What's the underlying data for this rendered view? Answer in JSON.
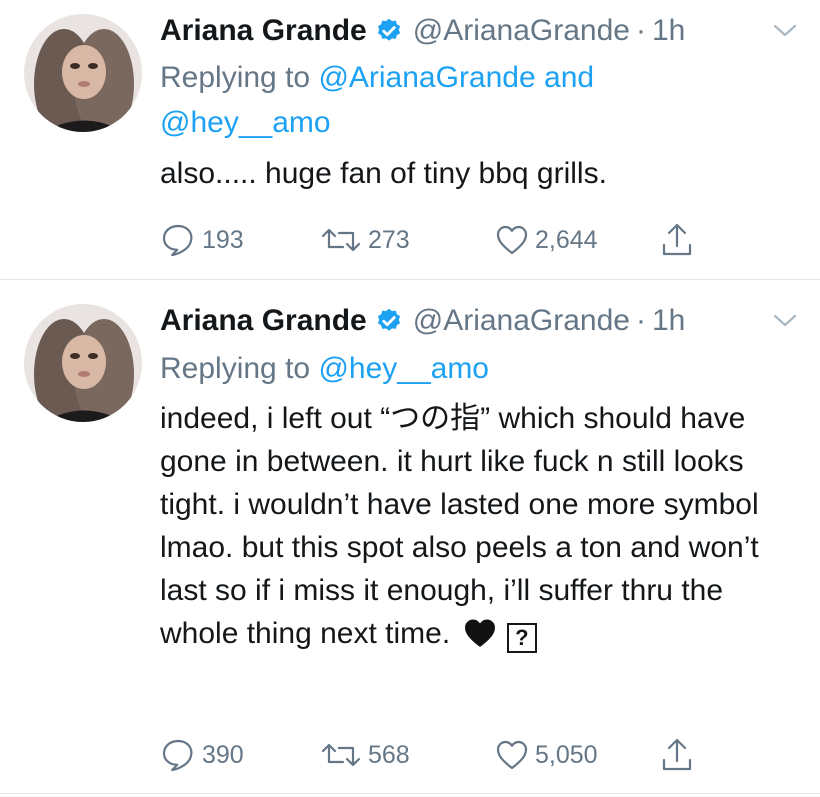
{
  "colors": {
    "text": "#14171a",
    "secondary": "#657786",
    "link": "#1da1f2",
    "verified": "#1da1f2",
    "divider": "#e1e8ed"
  },
  "tweets": [
    {
      "author_name": "Ariana Grande",
      "handle": "@ArianaGrande",
      "separator": "·",
      "time": "1h",
      "replying_prefix": "Replying to",
      "replying_mention_1": "@ArianaGrande",
      "replying_and": "and",
      "replying_mention_2": "@hey__amo",
      "text": "also..... huge fan of tiny bbq grills.",
      "replies": "193",
      "retweets": "273",
      "likes": "2,644"
    },
    {
      "author_name": "Ariana Grande",
      "handle": "@ArianaGrande",
      "separator": "·",
      "time": "1h",
      "replying_prefix": "Replying to",
      "replying_mention_1": "@hey__amo",
      "text": "indeed, i left out “つの指” which should have gone in between. it hurt like fuck n still looks tight. i wouldn’t have lasted one more symbol lmao. but this spot also peels a ton and won’t last so if i miss it enough, i’ll suffer thru the whole thing next time.",
      "emoji_1": "black-heart",
      "emoji_2": "?",
      "replies": "390",
      "retweets": "568",
      "likes": "5,050"
    }
  ]
}
